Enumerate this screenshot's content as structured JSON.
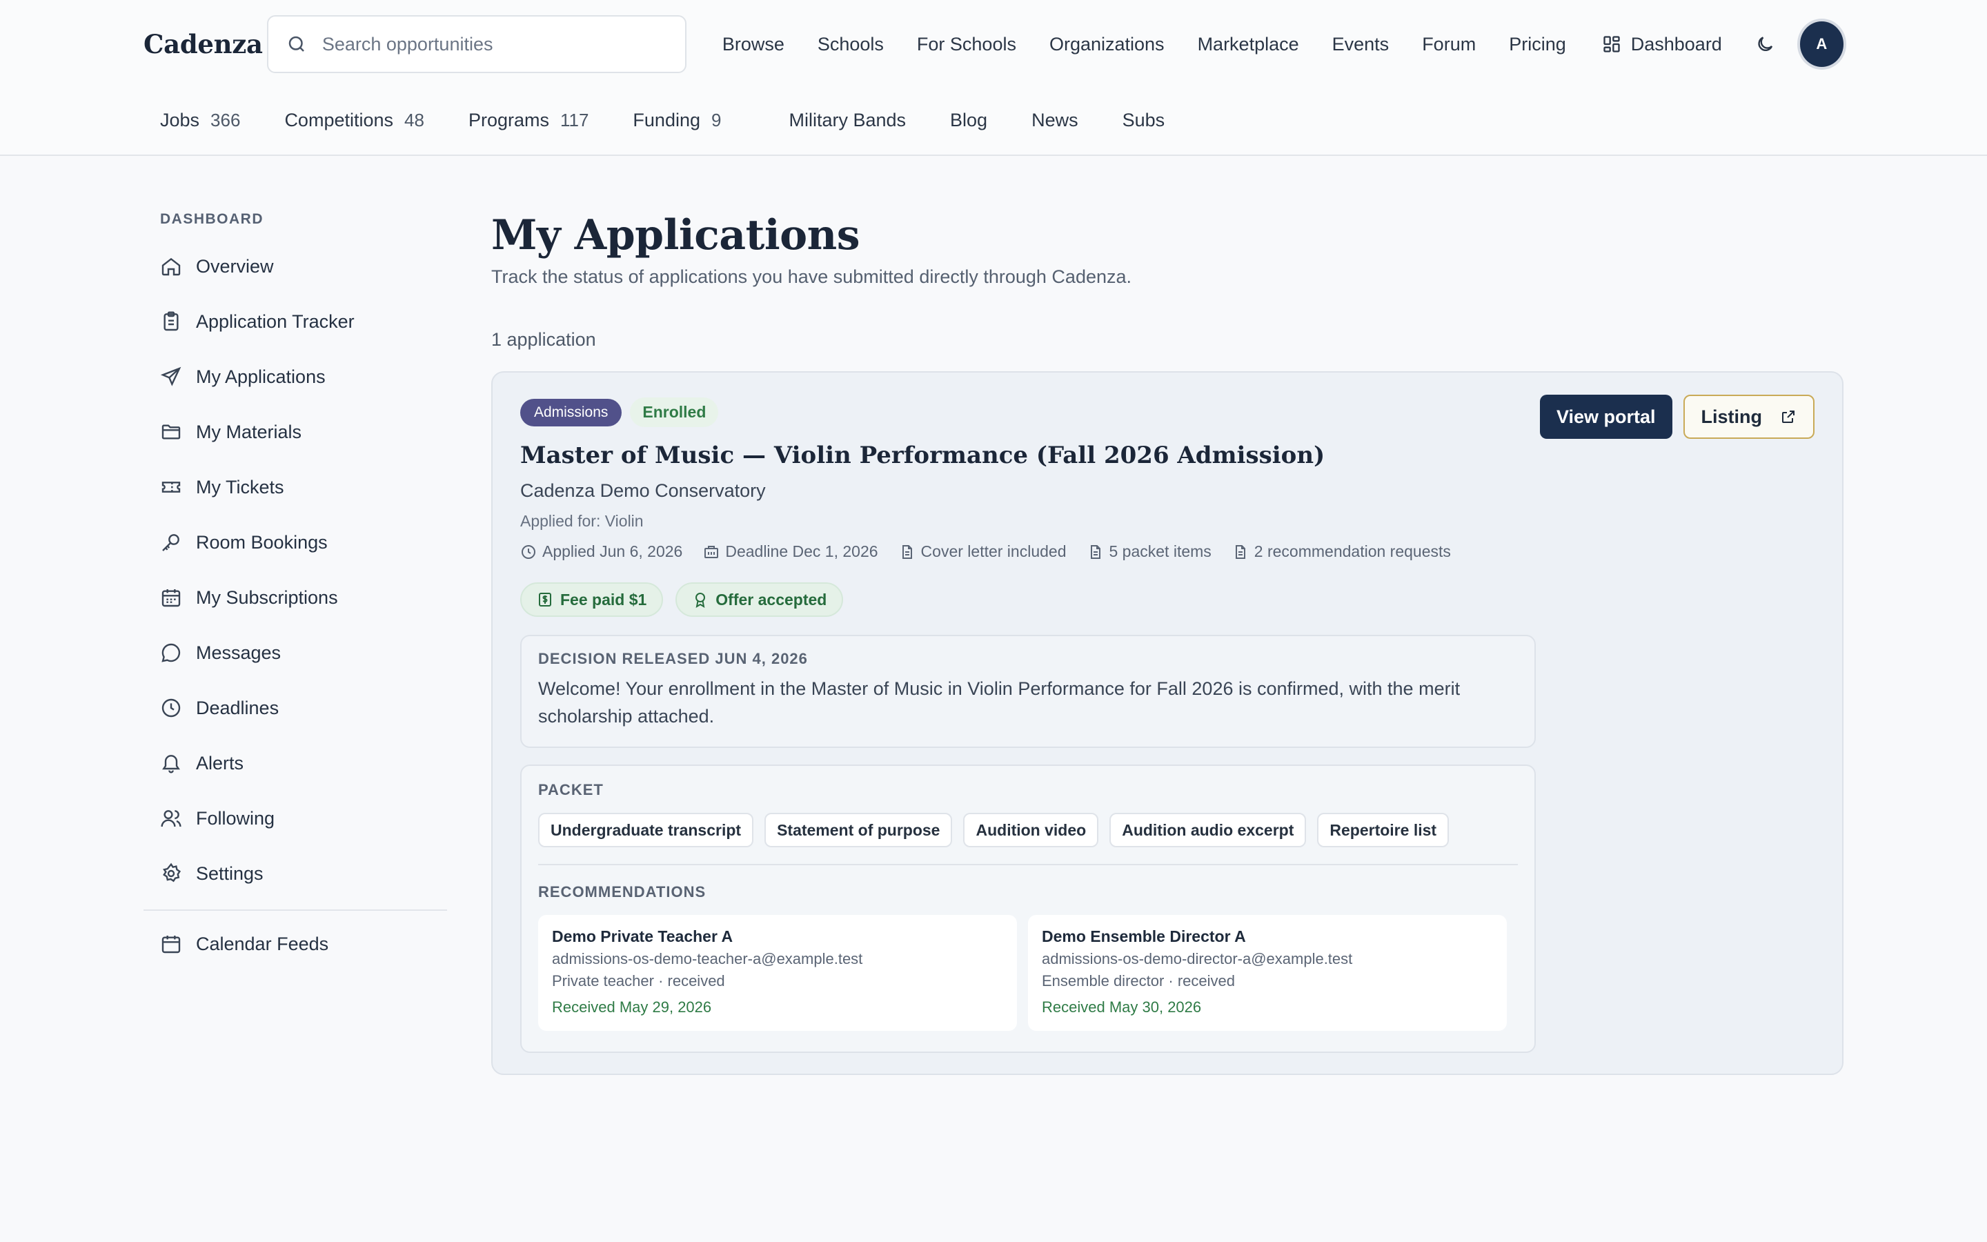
{
  "header": {
    "logo": "Cadenza",
    "search_placeholder": "Search opportunities",
    "nav": [
      "Browse",
      "Schools",
      "For Schools",
      "Organizations",
      "Marketplace",
      "Events",
      "Forum",
      "Pricing"
    ],
    "dashboard_label": "Dashboard",
    "avatar_initial": "A",
    "categories": [
      {
        "label": "Jobs",
        "count": "366"
      },
      {
        "label": "Competitions",
        "count": "48"
      },
      {
        "label": "Programs",
        "count": "117"
      },
      {
        "label": "Funding",
        "count": "9"
      }
    ],
    "links": [
      "Military Bands",
      "Blog",
      "News",
      "Subs"
    ]
  },
  "sidebar": {
    "heading": "DASHBOARD",
    "items": [
      {
        "label": "Overview",
        "icon": "home-icon"
      },
      {
        "label": "Application Tracker",
        "icon": "clipboard-icon"
      },
      {
        "label": "My Applications",
        "icon": "send-icon"
      },
      {
        "label": "My Materials",
        "icon": "folder-icon"
      },
      {
        "label": "My Tickets",
        "icon": "ticket-icon"
      },
      {
        "label": "Room Bookings",
        "icon": "key-icon"
      },
      {
        "label": "My Subscriptions",
        "icon": "calendar-grid-icon"
      },
      {
        "label": "Messages",
        "icon": "chat-bubble-icon"
      },
      {
        "label": "Deadlines",
        "icon": "clock-icon"
      },
      {
        "label": "Alerts",
        "icon": "bell-icon"
      },
      {
        "label": "Following",
        "icon": "users-icon"
      },
      {
        "label": "Settings",
        "icon": "gear-icon"
      }
    ],
    "footer_item": {
      "label": "Calendar Feeds",
      "icon": "calendar-icon"
    }
  },
  "main": {
    "title": "My Applications",
    "subtitle": "Track the status of applications you have submitted directly through Cadenza.",
    "count_text": "1 application",
    "application": {
      "badge_type": "Admissions",
      "badge_status": "Enrolled",
      "view_portal_label": "View portal",
      "listing_label": "Listing",
      "title": "Master of Music — Violin Performance (Fall 2026 Admission)",
      "school": "Cadenza Demo Conservatory",
      "applied_for": "Applied for: Violin",
      "meta": {
        "applied": "Applied Jun 6, 2026",
        "deadline": "Deadline Dec 1, 2026",
        "cover_letter": "Cover letter included",
        "packet_items": "5 packet items",
        "recommendations": "2 recommendation requests"
      },
      "pills": {
        "fee": "Fee paid $1",
        "offer": "Offer accepted"
      },
      "decision": {
        "heading": "DECISION RELEASED JUN 4, 2026",
        "text": "Welcome! Your enrollment in the Master of Music in Violin Performance for Fall 2026 is confirmed, with the merit scholarship attached."
      },
      "packet": {
        "heading": "PACKET",
        "items": [
          "Undergraduate transcript",
          "Statement of purpose",
          "Audition video",
          "Audition audio excerpt",
          "Repertoire list"
        ]
      },
      "recommendations": {
        "heading": "RECOMMENDATIONS",
        "items": [
          {
            "name": "Demo Private Teacher A",
            "email": "admissions-os-demo-teacher-a@example.test",
            "role": "Private teacher · received",
            "date": "Received May 29, 2026"
          },
          {
            "name": "Demo Ensemble Director A",
            "email": "admissions-os-demo-director-a@example.test",
            "role": "Ensemble director · received",
            "date": "Received May 30, 2026"
          }
        ]
      }
    }
  },
  "colors": {
    "navy": "#1b2f4e",
    "admissions_badge": "#51518a",
    "success_green": "#2f7b46",
    "listing_border": "#c9aa57",
    "card_bg": "#edf1f6"
  }
}
